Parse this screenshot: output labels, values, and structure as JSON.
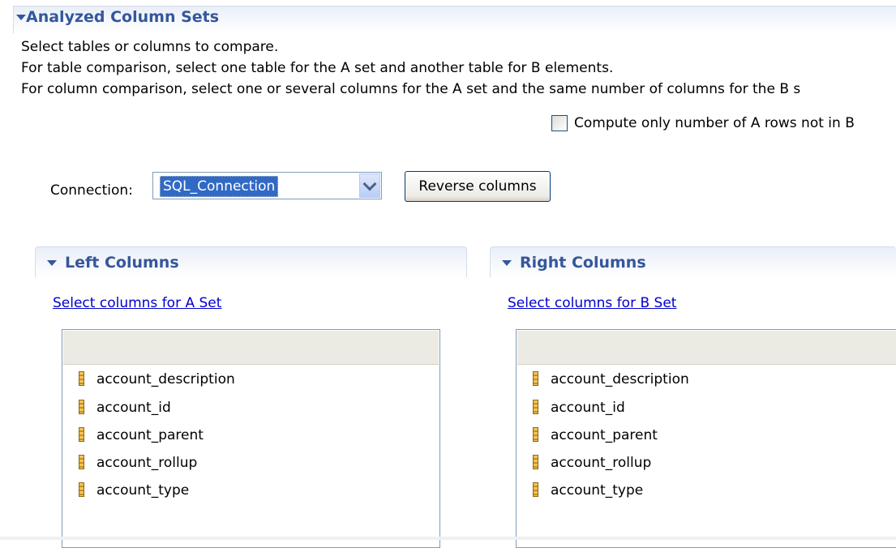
{
  "section": {
    "title": "Analyzed Column Sets",
    "description": [
      "Select tables or columns to compare.",
      "For table comparison, select one table for the A set and another table for B elements.",
      "For column comparison, select one or several columns for the A set and the same number of columns for the B s"
    ],
    "checkbox_label": "Compute only number of A rows not in B",
    "checkbox_checked": false
  },
  "connection": {
    "label": "Connection:",
    "value": "SQL_Connection",
    "reverse_button": "Reverse columns"
  },
  "left": {
    "title": "Left Columns",
    "link": "Select columns for A Set",
    "columns": [
      "account_description",
      "account_id",
      "account_parent",
      "account_rollup",
      "account_type"
    ]
  },
  "right": {
    "title": "Right Columns",
    "link": "Select columns for B Set",
    "columns": [
      "account_description",
      "account_id",
      "account_parent",
      "account_rollup",
      "account_type"
    ]
  },
  "icons": {
    "section_toggle": "chevron-down-icon",
    "column": "table-column-icon"
  },
  "colors": {
    "header_text": "#35569b",
    "link": "#0000cc",
    "selection": "#316ac5"
  }
}
